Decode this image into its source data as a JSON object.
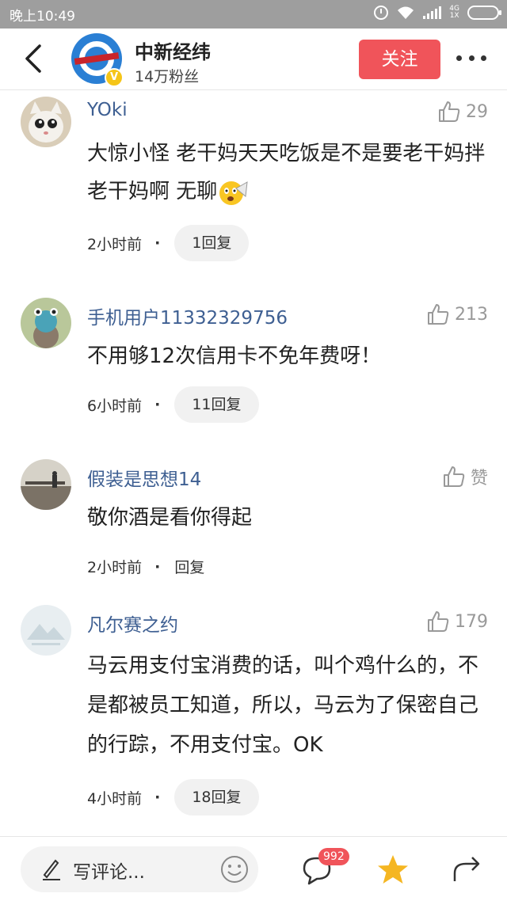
{
  "status_bar": {
    "time": "晚上10:49",
    "network": [
      "4G",
      "1X"
    ]
  },
  "header": {
    "account_name": "中新经纬",
    "fans": "14万粉丝",
    "follow_label": "关注",
    "verified_label": "V"
  },
  "comments": [
    {
      "user": "YOki",
      "likes": "29",
      "text": "大惊小怪 老干妈天天吃饭是不是要老干妈拌老干妈啊 无聊",
      "time": "2小时前",
      "dot": "·",
      "replies": "1回复"
    },
    {
      "user": "手机用户11332329756",
      "likes": "213",
      "text": "不用够12次信用卡不免年费呀！",
      "time": "6小时前",
      "dot": "·",
      "replies": "11回复"
    },
    {
      "user": "假装是思想14",
      "likes": "赞",
      "text": "敬你酒是看你得起",
      "time": "2小时前",
      "dot": "·",
      "replies": "回复"
    },
    {
      "user": "凡尔赛之约",
      "likes": "179",
      "text": "马云用支付宝消费的话，叫个鸡什么的，不是都被员工知道，所以，马云为了保密自己的行踪，不用支付宝。OK",
      "time": "4小时前",
      "dot": "·",
      "replies": "18回复"
    }
  ],
  "bottom_bar": {
    "placeholder": "写评论...",
    "comment_count": "992"
  },
  "colors": {
    "accent": "#f0545a",
    "username": "#3e5f92",
    "star": "#f5b622",
    "status_bar": "#9e9e9e"
  }
}
